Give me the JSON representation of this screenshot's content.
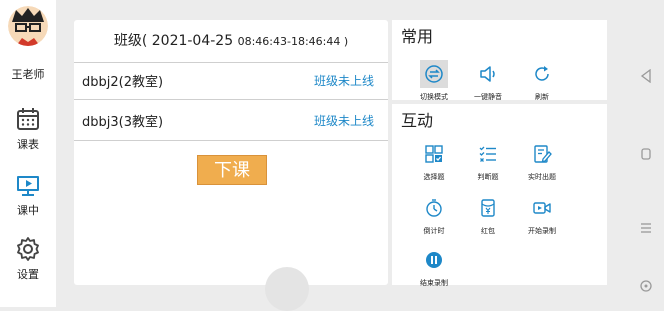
{
  "sidebar": {
    "teacher_name": "王老师",
    "nav": [
      {
        "label": "课表",
        "icon": "calendar-icon"
      },
      {
        "label": "课中",
        "icon": "monitor-play-icon"
      },
      {
        "label": "设置",
        "icon": "gear-icon"
      }
    ]
  },
  "main": {
    "title": "班级( 2021-04-25",
    "time_range": "08:46:43-18:46:44 )",
    "classes": [
      {
        "name": "dbbj2(2教室)",
        "status": "班级未上线"
      },
      {
        "name": "dbbj3(3教室)",
        "status": "班级未上线"
      }
    ],
    "end_class_label": "下课"
  },
  "common": {
    "title": "常用",
    "tools": [
      {
        "label": "切换模式",
        "icon": "switch-mode-icon"
      },
      {
        "label": "一键静音",
        "icon": "speaker-mute-icon"
      },
      {
        "label": "刷新",
        "icon": "refresh-icon"
      }
    ]
  },
  "interactive": {
    "title": "互动",
    "tools": [
      {
        "label": "选择题",
        "icon": "multiple-choice-icon"
      },
      {
        "label": "判断题",
        "icon": "true-false-icon"
      },
      {
        "label": "实时出题",
        "icon": "edit-question-icon"
      },
      {
        "label": "倒计时",
        "icon": "countdown-timer-icon"
      },
      {
        "label": "红包",
        "icon": "red-packet-icon"
      },
      {
        "label": "开始录制",
        "icon": "video-record-icon"
      },
      {
        "label": "结束录制",
        "icon": "stop-record-icon"
      }
    ]
  },
  "colors": {
    "accent": "#1e88c8",
    "end_button": "#f0ad4e"
  }
}
